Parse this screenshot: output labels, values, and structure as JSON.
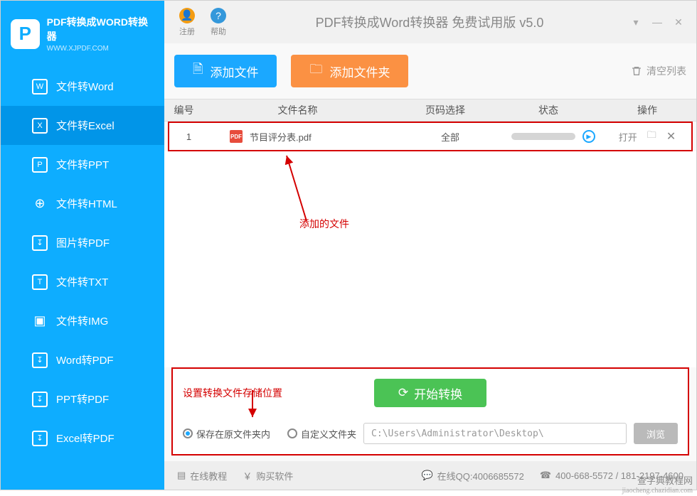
{
  "brand": {
    "name": "PDF转换成WORD转换器",
    "url": "WWW.XJPDF.COM",
    "logo_letter": "P"
  },
  "titlebar": {
    "register": "注册",
    "help": "帮助",
    "title": "PDF转换成Word转换器 免费试用版 v5.0"
  },
  "actions": {
    "add_file": "添加文件",
    "add_folder": "添加文件夹",
    "clear_list": "清空列表"
  },
  "sidebar": [
    {
      "label": "文件转Word",
      "icon": "W"
    },
    {
      "label": "文件转Excel",
      "icon": "X"
    },
    {
      "label": "文件转PPT",
      "icon": "P"
    },
    {
      "label": "文件转HTML",
      "icon": "⊕"
    },
    {
      "label": "图片转PDF",
      "icon": "↧"
    },
    {
      "label": "文件转TXT",
      "icon": "T"
    },
    {
      "label": "文件转IMG",
      "icon": "▣"
    },
    {
      "label": "Word转PDF",
      "icon": "↧"
    },
    {
      "label": "PPT转PDF",
      "icon": "↧"
    },
    {
      "label": "Excel转PDF",
      "icon": "↧"
    }
  ],
  "table": {
    "headers": {
      "no": "编号",
      "name": "文件名称",
      "pages": "页码选择",
      "status": "状态",
      "ops": "操作"
    },
    "rows": [
      {
        "no": "1",
        "name": "节目评分表.pdf",
        "pages": "全部",
        "open": "打开",
        "file_badge": "PDF"
      }
    ]
  },
  "callouts": {
    "added_file": "添加的文件",
    "save_location": "设置转换文件存储位置"
  },
  "start": {
    "label": "开始转换"
  },
  "save": {
    "opt1": "保存在原文件夹内",
    "opt2": "自定义文件夹",
    "path": "C:\\Users\\Administrator\\Desktop\\",
    "browse": "浏览"
  },
  "statusbar": {
    "tutorial": "在线教程",
    "buy": "购买软件",
    "qq": "在线QQ:4006685572",
    "phone": "400-668-5572 / 181-2197-4600"
  },
  "watermark": {
    "line1": "查字典教程网",
    "line2": "jiaocheng.chazidian.com"
  }
}
